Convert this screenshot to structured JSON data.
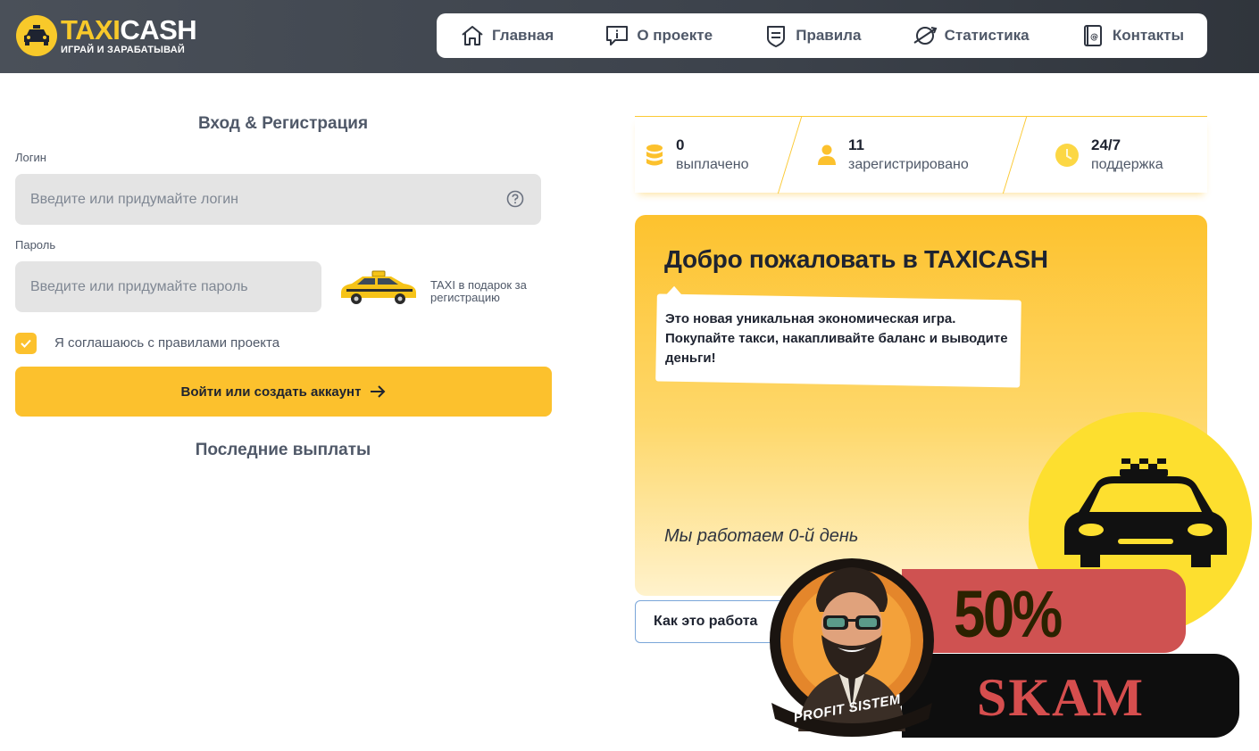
{
  "header": {
    "logo": {
      "title_part1": "TAXI",
      "title_part2": "CASH",
      "subtitle": "ИГРАЙ И ЗАРАБАТЫВАЙ"
    },
    "nav": [
      {
        "label": "Главная",
        "icon": "home-icon"
      },
      {
        "label": "О проекте",
        "icon": "info-bubble-icon"
      },
      {
        "label": "Правила",
        "icon": "rules-shield-icon"
      },
      {
        "label": "Статистика",
        "icon": "stats-orbit-icon"
      },
      {
        "label": "Контакты",
        "icon": "contacts-book-icon"
      }
    ]
  },
  "auth": {
    "title": "Вход & Регистрация",
    "login_label": "Логин",
    "login_placeholder": "Введите или придумайте логин",
    "password_label": "Пароль",
    "password_placeholder": "Введите или придумайте пароль",
    "gift_text": "TAXI в подарок за регистрацию",
    "agree_label": "Я соглашаюсь с правилами проекта",
    "agree_checked": true,
    "submit_label": "Войти или создать аккаунт"
  },
  "payouts": {
    "title": "Последние выплаты"
  },
  "stats": [
    {
      "value": "0",
      "label": "выплачено",
      "icon": "coins-icon"
    },
    {
      "value": "11",
      "label": "зарегистрировано",
      "icon": "user-icon"
    },
    {
      "value": "24/7",
      "label": "поддержка",
      "icon": "clock-icon"
    }
  ],
  "welcome": {
    "title": "Добро пожаловать в TAXICASH",
    "description": "Это новая уникальная экономическая игра. Покупайте такси, накапливайте баланс и выводите деньги!",
    "days_text": "Мы работаем 0-й день",
    "how_button": "Как это работа"
  },
  "overlay": {
    "percent": "50%",
    "word": "SKAM",
    "badge_text": "PROFIT SISTEM"
  },
  "colors": {
    "accent": "#fcc12d",
    "header_bg": "#3c424b",
    "text_muted": "#4f5868",
    "banner_red": "#cf5251"
  }
}
